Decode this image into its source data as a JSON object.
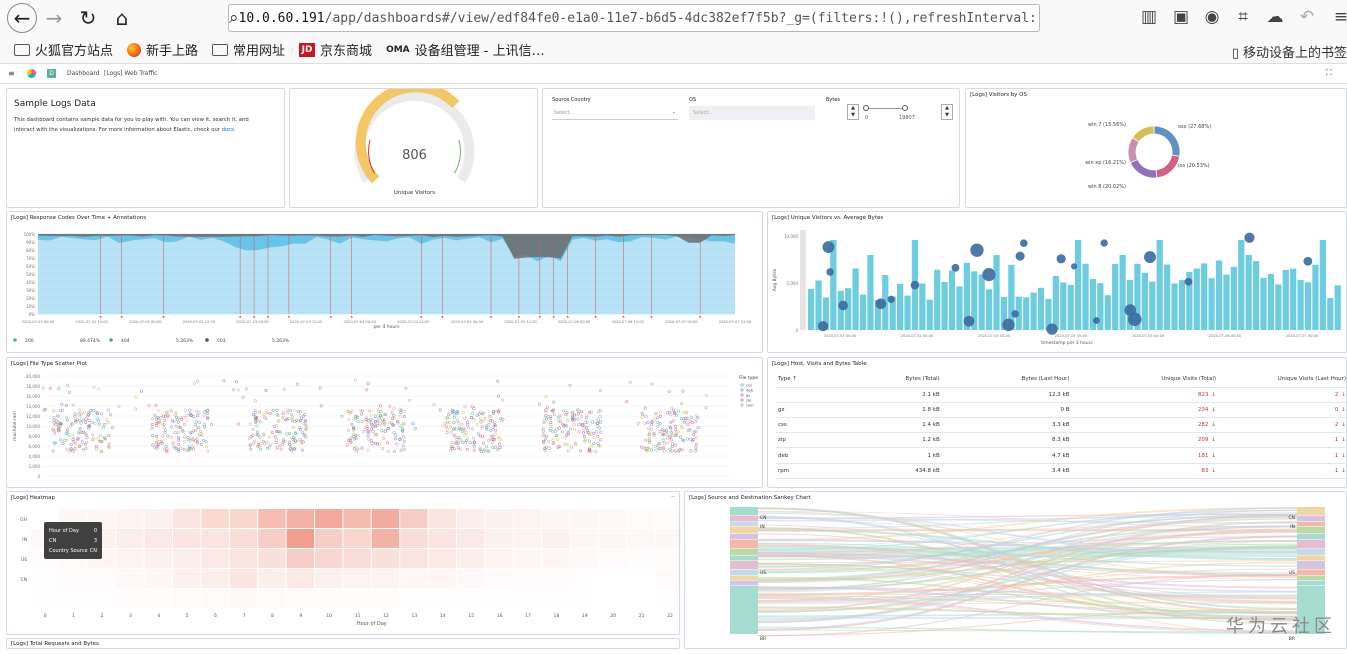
{
  "browser": {
    "url_host": "10.0.60.191",
    "url_rest": "/app/dashboards#/view/edf84fe0-e1a0-11e7-b6d5-4dc382ef7f5b?_g=(filters:!(),refreshInterval:(pause:!f",
    "bookmarks": [
      {
        "label": "火狐官方站点",
        "icon": "folder-icon"
      },
      {
        "label": "新手上路",
        "icon": "firefox-icon"
      },
      {
        "label": "常用网址",
        "icon": "folder-icon"
      },
      {
        "label": "京东商城",
        "icon": "jd-icon",
        "badge": "JD"
      },
      {
        "label": "设备组管理 - 上讯信…",
        "icon": "oma-icon",
        "badge": "OMA"
      }
    ],
    "mobile_bookmarks": "移动设备上的书签"
  },
  "kibana": {
    "crumb1": "Dashboard",
    "crumb2": "[Logs] Web Traffic",
    "logo_letter": "D"
  },
  "markdown": {
    "title": "Sample Logs Data",
    "line1": "This dashboard contains sample data for you to play with. You can view it, search it, and",
    "line2": "interact with the visualizations. For more information about Elastic, check our",
    "link": "docs."
  },
  "gauge": {
    "value": "806",
    "label": "Unique Visitors",
    "fraction": 0.68
  },
  "controls": {
    "country_label": "Source Country",
    "country_ph": "Select...",
    "os_label": "OS",
    "os_ph": "Select...",
    "bytes_label": "Bytes",
    "min": "0",
    "max": "19807"
  },
  "visitors_os": {
    "title": "[Logs] Visitors by OS",
    "slices": [
      {
        "name": "osx",
        "value": 27.68,
        "color": "#6092c0",
        "label": "osx (27.68%)"
      },
      {
        "name": "ios",
        "value": 20.53,
        "color": "#d36086",
        "label": "ios (20.53%)"
      },
      {
        "name": "win 8",
        "value": 20.02,
        "color": "#9170b8",
        "label": "win 8 (20.02%)"
      },
      {
        "name": "win xp",
        "value": 16.21,
        "color": "#ca8eae",
        "label": "win xp (16.21%)"
      },
      {
        "name": "win 7",
        "value": 15.56,
        "color": "#d6bf57",
        "label": "win 7 (15.56%)"
      }
    ]
  },
  "response_codes": {
    "title": "[Logs] Response Codes Over Time + Annotations",
    "xlabel": "per 4 hours",
    "yticks": [
      "100%",
      "90%",
      "80%",
      "70%",
      "60%",
      "50%",
      "40%",
      "30%",
      "20%",
      "10%",
      "0%"
    ],
    "xticks": [
      "2020-07-01 00:00",
      "2020-07-01 12:00",
      "2020-07-02 00:00",
      "2020-07-02 12:00",
      "2020-07-03 00:00",
      "2020-07-03 12:00",
      "2020-07-04 00:00",
      "2020-07-04 12:00",
      "2020-07-05 00:00",
      "2020-07-05 12:00",
      "2020-07-06 00:00",
      "2020-07-06 12:00",
      "2020-07-07 00:00",
      "2020-07-07 12:00"
    ],
    "legend": [
      {
        "label": "200",
        "value": "89.474%",
        "color": "#54b399"
      },
      {
        "label": "404",
        "value": "5.263%",
        "color": "#6092c0"
      },
      {
        "label": "503",
        "value": "5.263%",
        "color": "#525252"
      }
    ]
  },
  "unique_avg": {
    "title": "[Logs] Unique Visitors vs. Average Bytes",
    "ylabel": "Avg Bytes",
    "xlabel": "timestamp per 3 hours",
    "yticks": [
      "10,000",
      "5,000",
      "0"
    ],
    "xticks": [
      "2020-07-01 00:00",
      "2020-07-02 00:00",
      "2020-07-03 00:00",
      "2020-07-04 00:00",
      "2020-07-05 00:00",
      "2020-07-06 00:00",
      "2020-07-07 00:00"
    ]
  },
  "scatter": {
    "title": "[Logs] File Type Scatter Plot",
    "legend_title": "File type",
    "legend": [
      "css",
      "deb",
      "gz",
      "zip",
      "rpm"
    ],
    "ylabel": "machine.ram",
    "yticks": [
      "20,000",
      "18,000",
      "16,000",
      "14,000",
      "12,000",
      "10,000",
      "8,000",
      "6,000",
      "4,000",
      "2,000",
      "0"
    ]
  },
  "table": {
    "title": "[Logs] Host, Visits and Bytes Table",
    "headers": [
      "Type",
      "Bytes (Total)",
      "Bytes (Last Hour)",
      "Unique Visits (Total)",
      "Unique Visits (Last Hour)"
    ],
    "rows": [
      [
        "",
        "2.1 kB",
        "12.3 kB",
        "823",
        "2"
      ],
      [
        "gz",
        "1.8 kB",
        "0 B",
        "234",
        "0"
      ],
      [
        "css",
        "1.4 kB",
        "3.3 kB",
        "282",
        "2"
      ],
      [
        "zip",
        "1.2 kB",
        "8.3 kB",
        "209",
        "1"
      ],
      [
        "deb",
        "1 kB",
        "4.7 kB",
        "181",
        "1"
      ],
      [
        "rpm",
        "434.8 kB",
        "3.4 kB",
        "83",
        "1"
      ]
    ]
  },
  "heatmap": {
    "title": "[Logs] Heatmap",
    "xlabel": "Hour of Day",
    "ylabels": [
      "GH",
      "IN",
      "US",
      "CN",
      ""
    ],
    "xticks": [
      "0",
      "1",
      "2",
      "3",
      "4",
      "5",
      "6",
      "7",
      "8",
      "9",
      "10",
      "11",
      "12",
      "13",
      "14",
      "15",
      "16",
      "17",
      "18",
      "19",
      "20",
      "21",
      "22",
      "23"
    ],
    "tooltip": {
      "r1k": "Hour of Day",
      "r1v": "0",
      "r2k": "CN",
      "r2v": "3",
      "r3k": "Country Source",
      "r3v": "CN"
    },
    "color": "#e7664c"
  },
  "sankey": {
    "title": "[Logs] Source and Destination Sankey Chart",
    "left": [
      "CN",
      "IN",
      "US",
      "BR"
    ],
    "right": [
      "CN",
      "IN",
      "US",
      "BR"
    ]
  },
  "total_req": {
    "title": "[Logs] Total Requests and Bytes"
  },
  "watermark": "华为云社区"
}
